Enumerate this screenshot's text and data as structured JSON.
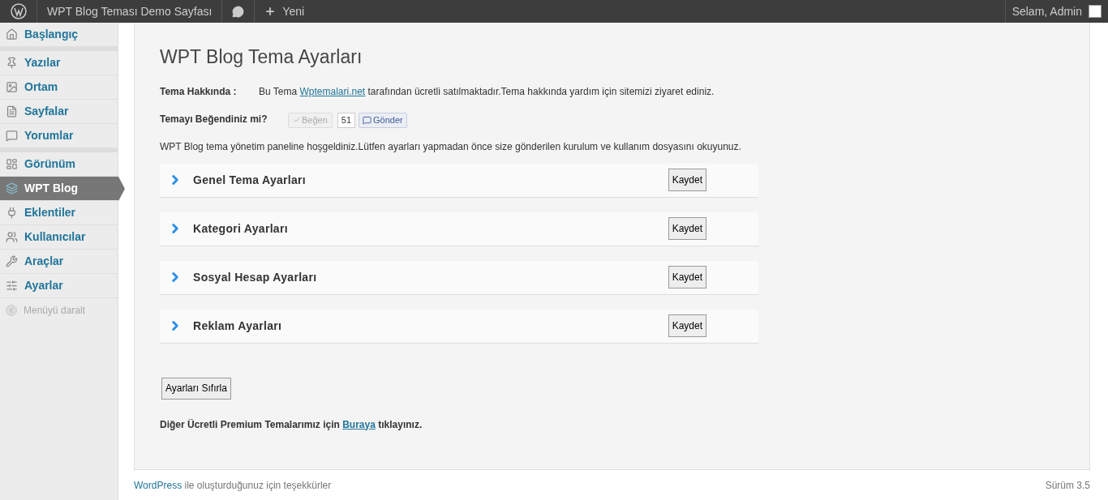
{
  "admin_bar": {
    "site_name": "WPT Blog Teması Demo Sayfası",
    "new_label": "Yeni",
    "greeting": "Selam, Admin"
  },
  "sidebar": {
    "groups": [
      [
        {
          "label": "Başlangıç",
          "kind": "home",
          "selected": false
        }
      ],
      [
        {
          "label": "Yazılar",
          "kind": "pin",
          "selected": false
        },
        {
          "label": "Ortam",
          "kind": "media",
          "selected": false
        },
        {
          "label": "Sayfalar",
          "kind": "pages",
          "selected": false
        },
        {
          "label": "Yorumlar",
          "kind": "comment",
          "selected": false
        }
      ],
      [
        {
          "label": "Görünüm",
          "kind": "layout",
          "selected": false
        },
        {
          "label": "WPT Blog",
          "kind": "theme",
          "selected": true
        },
        {
          "label": "Eklentiler",
          "kind": "plug",
          "selected": false
        },
        {
          "label": "Kullanıcılar",
          "kind": "users",
          "selected": false
        },
        {
          "label": "Araçlar",
          "kind": "tools",
          "selected": false
        },
        {
          "label": "Ayarlar",
          "kind": "settings",
          "selected": false
        }
      ]
    ],
    "collapse_label": "Menüyü daralt"
  },
  "page": {
    "title": "WPT Blog Tema Ayarları",
    "about": {
      "label": "Tema Hakkında :",
      "text_before": "Bu Tema",
      "link": "Wptemalari.net",
      "text_after": "tarafından ücretli satılmaktadır.Tema hakkında yardım için sitemizi ziyaret ediniz."
    },
    "like": {
      "label": "Temayı Beğendiniz mi?",
      "like_button": "Beğen",
      "count": "51",
      "send_button": "Gönder"
    },
    "welcome": "WPT Blog tema yönetim paneline hoşgeldiniz.Lütfen ayarları yapmadan önce size gönderilen kurulum ve kullanım dosyasını okuyunuz.",
    "sections": [
      {
        "title": "Genel Tema Ayarları",
        "button": "Kaydet",
        "expanded": false
      },
      {
        "title": "Kategori Ayarları",
        "button": "Kaydet",
        "expanded": false
      },
      {
        "title": "Sosyal Hesap Ayarları",
        "button": "Kaydet",
        "expanded": false
      },
      {
        "title": "Reklam Ayarları",
        "button": "Kaydet",
        "expanded": false
      }
    ],
    "reset_button": "Ayarları Sıfırla",
    "premium": {
      "text_before": "Diğer Ücretli Premium Temalarımız için",
      "link": "Buraya",
      "text_after": "tıklayınız."
    }
  },
  "footer": {
    "link": "WordPress",
    "text": "ile oluşturduğunuz için teşekkürler",
    "version": "Sürüm 3.5"
  }
}
